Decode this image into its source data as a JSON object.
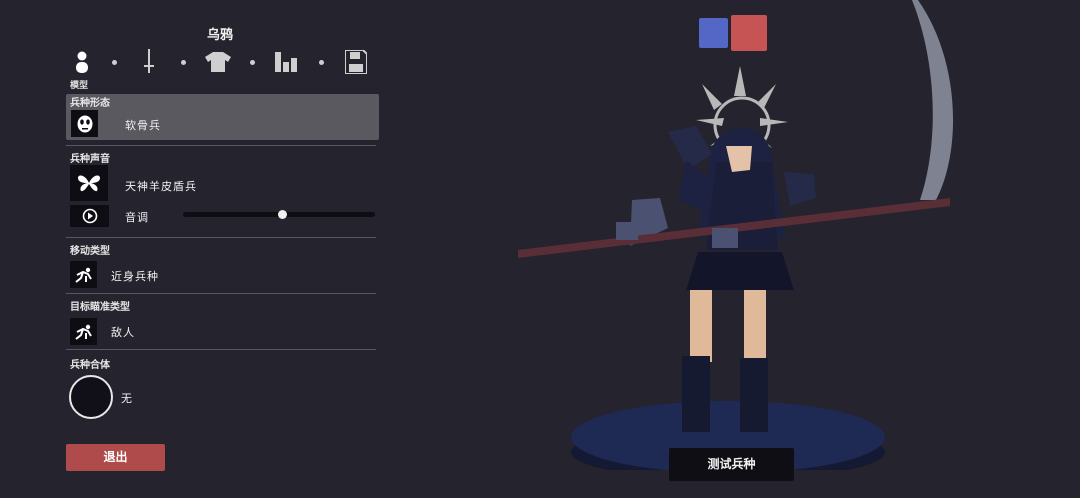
{
  "title": "乌鸦",
  "tabs": {
    "active_label": "模型",
    "icons": [
      "person-icon",
      "sword-icon",
      "shirt-icon",
      "stats-icon",
      "save-icon"
    ]
  },
  "sections": {
    "unit_form": {
      "label": "兵种形态",
      "value": "软骨兵",
      "icon": "mask-icon"
    },
    "unit_voice": {
      "label": "兵种声音",
      "value": "天神羊皮盾兵",
      "icon": "butterfly-icon",
      "pitch_label": "音调",
      "pitch_level": 0.52
    },
    "movement_type": {
      "label": "移动类型",
      "value": "近身兵种",
      "icon": "running-figure-icon"
    },
    "target_type": {
      "label": "目标瞄准类型",
      "value": "敌人",
      "icon": "target-figure-icon"
    },
    "unit_merge": {
      "label": "兵种合体",
      "value": "无"
    }
  },
  "buttons": {
    "exit": "退出",
    "test_unit": "测试兵种"
  },
  "team_colors": {
    "blue": "#5466c6",
    "red": "#c65454"
  }
}
